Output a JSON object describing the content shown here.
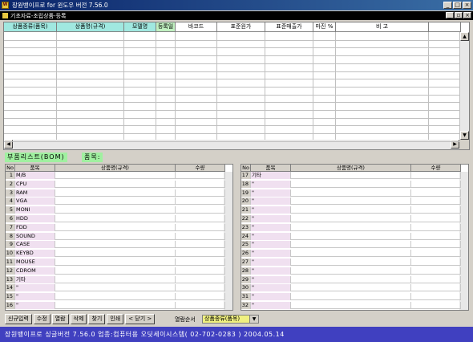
{
  "window": {
    "title": "장원뱅이프로 for 윈도우 버전 7.56.0",
    "min": "_",
    "max": "□",
    "close": "×"
  },
  "child": {
    "title": "기초자료-조립상품-등록",
    "min": "_",
    "restore": "▫",
    "close": "×"
  },
  "main_grid": {
    "headers": [
      "상품종류(품목)",
      "상품명(규격)",
      "모델명",
      "등록일",
      "바코드",
      "표준원가",
      "표준매출가",
      "마진 %",
      "비 고"
    ],
    "header_colors": [
      "#a0e8e0",
      "#a0e8e0",
      "#a0e8e0",
      "#c0f0c0",
      "#ffffff",
      "#ffffff",
      "#ffffff",
      "#ffffff",
      "#ffffff"
    ],
    "row_count": 14
  },
  "bom": {
    "label": "부품리스트(BOM)",
    "item_label": "품목:"
  },
  "left_table": {
    "headers": [
      "No",
      "품목",
      "상품명(규격)",
      "수량"
    ],
    "rows": [
      [
        "1",
        "M/B"
      ],
      [
        "2",
        "CPU"
      ],
      [
        "3",
        "RAM"
      ],
      [
        "4",
        "VGA"
      ],
      [
        "5",
        "MONI"
      ],
      [
        "6",
        "HDD"
      ],
      [
        "7",
        "FDD"
      ],
      [
        "8",
        "SOUND"
      ],
      [
        "9",
        "CASE"
      ],
      [
        "10",
        "KEYBD"
      ],
      [
        "11",
        "MOUSE"
      ],
      [
        "12",
        "CDROM"
      ],
      [
        "13",
        "기타"
      ],
      [
        "14",
        "\""
      ],
      [
        "15",
        "\""
      ],
      [
        "16",
        "\""
      ]
    ]
  },
  "right_table": {
    "headers": [
      "No",
      "품목",
      "상품명(규격)",
      "수량"
    ],
    "rows": [
      [
        "17",
        "기타"
      ],
      [
        "18",
        "\""
      ],
      [
        "19",
        "\""
      ],
      [
        "20",
        "\""
      ],
      [
        "21",
        "\""
      ],
      [
        "22",
        "\""
      ],
      [
        "23",
        "\""
      ],
      [
        "24",
        "\""
      ],
      [
        "25",
        "\""
      ],
      [
        "26",
        "\""
      ],
      [
        "27",
        "\""
      ],
      [
        "28",
        "\""
      ],
      [
        "29",
        "\""
      ],
      [
        "30",
        "\""
      ],
      [
        "31",
        "\""
      ],
      [
        "32",
        "\""
      ]
    ]
  },
  "buttons": [
    "신규입력",
    "수정",
    "열람",
    "삭제",
    "찾기",
    "인쇄",
    "< 닫기 >"
  ],
  "sort": {
    "label": "열람순서",
    "value": "상품종류(품목)"
  },
  "status": "장원뱅이프로 싱글버전 7.56.0   업종:컴퓨터용   오딧세이시스템( 02-702-0283 )   2004.05.14"
}
